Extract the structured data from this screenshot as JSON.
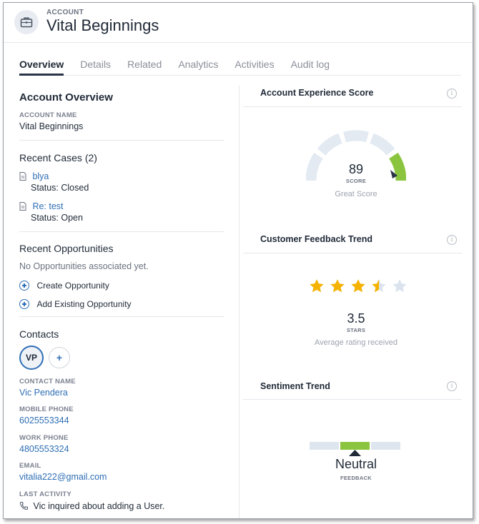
{
  "header": {
    "eyebrow": "ACCOUNT",
    "title": "Vital Beginnings",
    "icon": "briefcase-icon"
  },
  "tabs": [
    {
      "label": "Overview",
      "active": true
    },
    {
      "label": "Details"
    },
    {
      "label": "Related"
    },
    {
      "label": "Analytics"
    },
    {
      "label": "Activities"
    },
    {
      "label": "Audit log"
    }
  ],
  "overview": {
    "title": "Account Overview",
    "account_name_label": "ACCOUNT NAME",
    "account_name": "Vital Beginnings"
  },
  "cases": {
    "title": "Recent Cases (2)",
    "items": [
      {
        "name": "blya",
        "status": "Status: Closed"
      },
      {
        "name": "Re: test",
        "status": "Status: Open"
      }
    ]
  },
  "opportunities": {
    "title": "Recent Opportunities",
    "empty": "No Opportunities associated yet.",
    "create_label": "Create Opportunity",
    "add_existing_label": "Add Existing Opportunity"
  },
  "contacts": {
    "title": "Contacts",
    "avatar_initials": "VP",
    "add_symbol": "+",
    "contact_name_label": "CONTACT NAME",
    "contact_name": "Vic Pendera",
    "mobile_label": "MOBILE PHONE",
    "mobile": "6025553344",
    "work_label": "WORK PHONE",
    "work": "4805553324",
    "email_label": "EMAIL",
    "email": "vitalia222@gmail.com",
    "last_activity_label": "LAST ACTIVITY",
    "last_activity": "Vic inquired about adding a User."
  },
  "experience": {
    "title": "Account Experience Score",
    "score": "89",
    "score_label": "SCORE",
    "caption": "Great Score",
    "score_value": 89,
    "accent_color": "#8bc53f"
  },
  "feedback": {
    "title": "Customer Feedback Trend",
    "rating": "3.5",
    "rating_value": 3.5,
    "max_stars": 5,
    "stars_label": "STARS",
    "caption": "Average rating received",
    "star_color": "#f5b301"
  },
  "sentiment": {
    "title": "Sentiment Trend",
    "value": "Neutral",
    "label": "FEEDBACK",
    "accent_color": "#8bc53f"
  },
  "info_symbol": "i"
}
